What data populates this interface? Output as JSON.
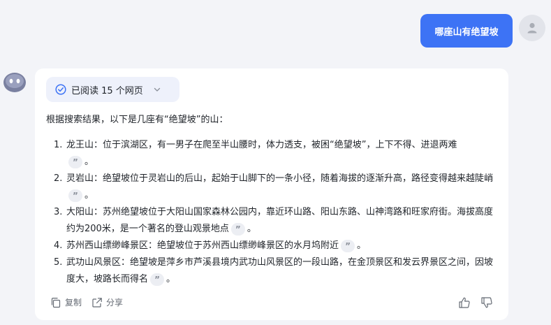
{
  "user": {
    "message": "哪座山有绝望坡"
  },
  "answer": {
    "sources_label": "已阅读 15 个网页",
    "intro": "根据搜索结果，以下是几座有“绝望坡”的山：",
    "items": [
      {
        "num": "1.",
        "text": "龙王山：位于滨湖区，有一男子在爬至半山腰时，体力透支，被困“绝望坡”，上下不得、进退两难",
        "tail": "。"
      },
      {
        "num": "2.",
        "text": "灵岩山：绝望坡位于灵岩山的后山，起始于山脚下的一条小径，随着海拔的逐渐升高，路径变得越来越陡峭",
        "tail": "。"
      },
      {
        "num": "3.",
        "text": "大阳山：苏州绝望坡位于大阳山国家森林公园内，靠近环山路、阳山东路、山神湾路和旺家府街。海拔高度约为200米，是一个著名的登山观景地点",
        "tail": "。"
      },
      {
        "num": "4.",
        "text": "苏州西山缥缈峰景区：绝望坡位于苏州西山缥缈峰景区的水月坞附近",
        "tail": "。"
      },
      {
        "num": "5.",
        "text": "武功山风景区：绝望坡是萍乡市芦溪县境内武功山风景区的一段山路，在金顶景区和发云界景区之间，因坡度大，坡路长而得名",
        "tail": "。"
      }
    ],
    "copy_label": "复制",
    "share_label": "分享"
  },
  "colors": {
    "accent": "#3d73f5",
    "page_bg": "#f3f4f8",
    "card_bg": "#ffffff",
    "pill_bg": "#eef1fb"
  },
  "icons": {
    "sources": "check-circle-icon",
    "expand": "chevron-down-icon",
    "copy": "copy-icon",
    "share": "share-icon",
    "like": "thumbs-up-icon",
    "dislike": "thumbs-down-icon",
    "citation": "quote-icon"
  }
}
